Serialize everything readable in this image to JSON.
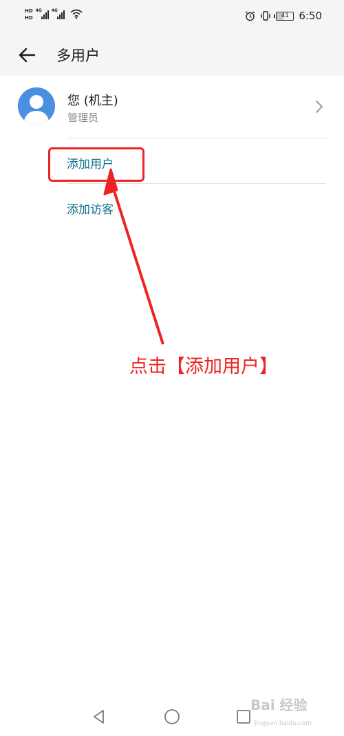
{
  "status_bar": {
    "hd1": "HD",
    "hd2": "HD",
    "sig1": "4G",
    "sig2": "4G",
    "battery": "41",
    "battery_level": 0.41,
    "time": "6:50"
  },
  "header": {
    "back_icon": "arrow-left-icon",
    "title": "多用户"
  },
  "owner": {
    "avatar_icon": "person-avatar-icon",
    "name": "您 (机主)",
    "role": "管理员",
    "chevron_icon": "chevron-right-icon"
  },
  "actions": {
    "add_user": "添加用户",
    "add_guest": "添加访客"
  },
  "annotation": {
    "text": "点击【添加用户】",
    "color": "#ee2222"
  },
  "nav": {
    "back_icon": "triangle-back-icon",
    "home_icon": "circle-home-icon",
    "recent_icon": "square-recent-icon"
  },
  "watermark": {
    "brand": "Bai 经验",
    "url": "jingyan.baidu.com"
  },
  "colors": {
    "accent": "#0a6e8c",
    "avatar": "#4a90e2",
    "header_bg": "#f5f5f5"
  }
}
